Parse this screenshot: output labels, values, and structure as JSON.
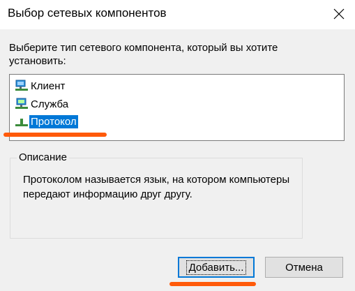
{
  "window": {
    "title": "Выбор сетевых компонентов",
    "close_icon": "close-icon"
  },
  "prompt": "Выберите тип сетевого компонента, который вы хотите установить:",
  "component_list": {
    "items": [
      {
        "label": "Клиент",
        "icon": "network-client-icon",
        "selected": false
      },
      {
        "label": "Служба",
        "icon": "network-service-icon",
        "selected": false
      },
      {
        "label": "Протокол",
        "icon": "network-protocol-icon",
        "selected": true
      }
    ]
  },
  "description": {
    "legend": "Описание",
    "text": "Протоколом называется язык, на котором компьютеры передают информацию друг другу."
  },
  "buttons": {
    "add_label": "Добавить...",
    "cancel_label": "Отмена"
  },
  "colors": {
    "selection": "#0078d7",
    "annotation_underline": "#ff5a0a",
    "dialog_background": "#f0f0f0"
  }
}
